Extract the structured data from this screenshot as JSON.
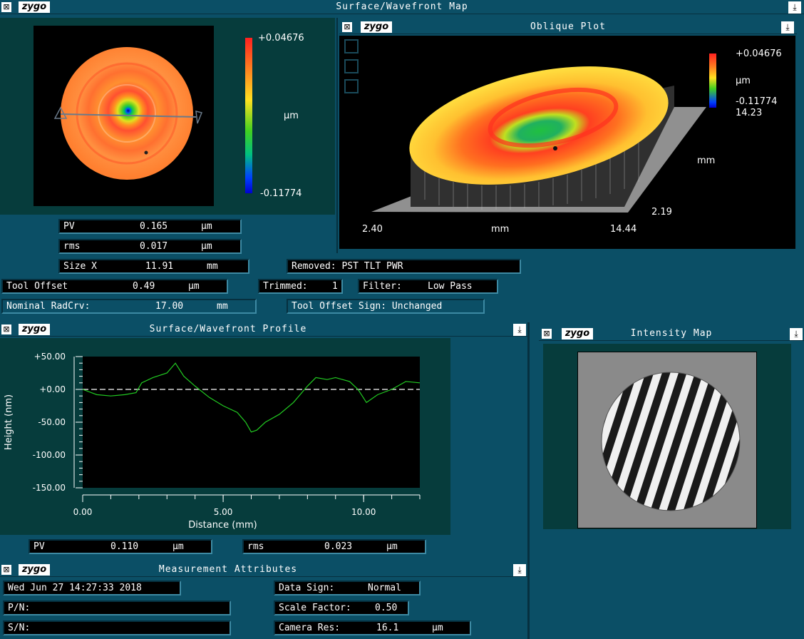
{
  "surface_map": {
    "title": "Surface/Wavefront Map",
    "logo": "zygo",
    "scale_max": "+0.04676",
    "scale_unit": "µm",
    "scale_min": "-0.11774",
    "pv": {
      "label": "PV",
      "value": "0.165",
      "unit": "µm"
    },
    "rms": {
      "label": "rms",
      "value": "0.017",
      "unit": "µm"
    },
    "size_x": {
      "label": "Size X",
      "value": "11.91",
      "unit": "mm"
    },
    "removed": "Removed: PST TLT PWR",
    "tool_offset": {
      "label": "Tool Offset",
      "value": "0.49",
      "unit": "µm"
    },
    "trimmed": {
      "label": "Trimmed:",
      "value": "1"
    },
    "filter": {
      "label": "Filter:",
      "value": "Low Pass"
    },
    "nominal_radcrv": {
      "label": "Nominal RadCrv:",
      "value": "17.00",
      "unit": "mm"
    },
    "tool_offset_sign": "Tool Offset Sign: Unchanged"
  },
  "oblique_plot": {
    "title": "Oblique Plot",
    "logo": "zygo",
    "scale_max": "+0.04676",
    "scale_unit": "µm",
    "scale_min": "-0.11774",
    "y_top": "14.23",
    "y_unit": "mm",
    "y_bottom": "2.19",
    "x_left": "2.40",
    "x_unit": "mm",
    "x_right": "14.44"
  },
  "profile": {
    "title": "Surface/Wavefront Profile",
    "logo": "zygo",
    "pv": {
      "label": "PV",
      "value": "0.110",
      "unit": "µm"
    },
    "rms": {
      "label": "rms",
      "value": "0.023",
      "unit": "µm"
    }
  },
  "chart_data": {
    "type": "line",
    "title": "",
    "xlabel": "Distance (mm)",
    "ylabel": "Height (nm)",
    "xlim": [
      0,
      12
    ],
    "ylim": [
      -150,
      50
    ],
    "x_ticks": [
      "0.00",
      "5.00",
      "10.00"
    ],
    "y_ticks": [
      "+50.00",
      "+0.00",
      "-50.00",
      "-100.00",
      "-150.00"
    ],
    "series": [
      {
        "x": [
          0,
          0.5,
          1.0,
          1.5,
          1.9,
          2.1,
          2.5,
          3.0,
          3.3,
          3.6,
          4.0,
          4.5,
          5.0,
          5.5,
          5.8,
          6.0,
          6.2,
          6.5,
          7.0,
          7.5,
          8.0,
          8.3,
          8.7,
          9.0,
          9.5,
          9.8,
          10.1,
          10.5,
          11.0,
          11.5,
          12.0
        ],
        "y": [
          0,
          -8,
          -10,
          -8,
          -5,
          10,
          18,
          25,
          40,
          20,
          5,
          -12,
          -25,
          -35,
          -50,
          -65,
          -62,
          -50,
          -38,
          -20,
          5,
          18,
          15,
          18,
          12,
          0,
          -20,
          -8,
          0,
          12,
          10
        ],
        "color": "#22cc22"
      }
    ],
    "reference_line": 0
  },
  "intensity": {
    "title": "Intensity Map",
    "logo": "zygo"
  },
  "attributes": {
    "title": "Measurement Attributes",
    "logo": "zygo",
    "datetime": "Wed Jun 27 14:27:33 2018",
    "pn": "P/N:",
    "sn": "S/N:",
    "data_sign": {
      "label": "Data Sign:",
      "value": "Normal"
    },
    "scale_factor": {
      "label": "Scale Factor:",
      "value": "0.50"
    },
    "camera_res": {
      "label": "Camera Res:",
      "value": "16.1",
      "unit": "µm"
    }
  },
  "icons": {
    "close": "close-box-icon",
    "pin": "pin-icon"
  },
  "colors": {
    "background": "#0b4f66",
    "panel": "#063c3c",
    "trace": "#22cc22"
  }
}
